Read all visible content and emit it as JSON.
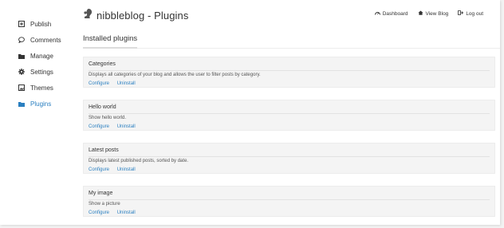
{
  "header": {
    "title": "nibbleblog - Plugins",
    "logo_icon": "squirrel-icon",
    "nav": [
      {
        "label": "Dashboard",
        "icon": "dashboard-icon"
      },
      {
        "label": "View Blog",
        "icon": "home-icon"
      },
      {
        "label": "Log out",
        "icon": "logout-icon"
      }
    ]
  },
  "sidebar": {
    "items": [
      {
        "label": "Publish",
        "icon": "publish-icon"
      },
      {
        "label": "Comments",
        "icon": "comment-icon"
      },
      {
        "label": "Manage",
        "icon": "folder-icon"
      },
      {
        "label": "Settings",
        "icon": "gear-icon"
      },
      {
        "label": "Themes",
        "icon": "image-icon"
      },
      {
        "label": "Plugins",
        "icon": "folder-icon",
        "active": true
      }
    ]
  },
  "main": {
    "section_title": "Installed plugins",
    "plugins": [
      {
        "name": "Categories",
        "description": "Displays all categories of your blog and allows the user to filter posts by category.",
        "configure": "Configure",
        "uninstall": "Uninstall"
      },
      {
        "name": "Hello world",
        "description": "Show hello world.",
        "configure": "Configure",
        "uninstall": "Uninstall"
      },
      {
        "name": "Latest posts",
        "description": "Displays latest published posts, sorted by date.",
        "configure": "Configure",
        "uninstall": "Uninstall"
      },
      {
        "name": "My image",
        "description": "Show a picture",
        "configure": "Configure",
        "uninstall": "Uninstall"
      }
    ]
  },
  "colors": {
    "accent": "#2a7fc0",
    "card_bg": "#f4f4f4",
    "text": "#333333"
  }
}
